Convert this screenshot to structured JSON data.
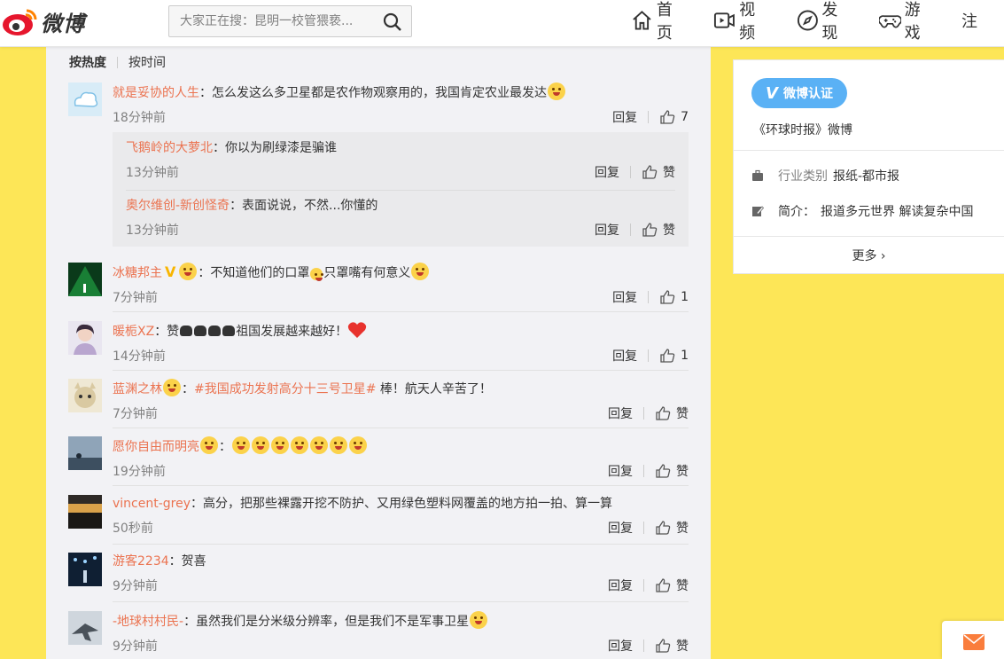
{
  "header": {
    "logo_text": "微博",
    "search_placeholder": "大家正在搜：昆明一校管猥亵...",
    "nav": [
      {
        "label": "首页",
        "icon": "home-icon"
      },
      {
        "label": "视频",
        "icon": "video-icon"
      },
      {
        "label": "发现",
        "icon": "compass-icon"
      },
      {
        "label": "游戏",
        "icon": "gamepad-icon"
      },
      {
        "label": "注",
        "icon": ""
      }
    ]
  },
  "sort": {
    "active": "按热度",
    "other": "按时间"
  },
  "actions": {
    "reply": "回复",
    "like_default": "赞"
  },
  "comments": [
    {
      "user": "就是妥协的人生",
      "text": "：怎么发这么多卫星都是农作物观察用的，我国肯定农业最发达",
      "time": "18分钟前",
      "likes": "7"
    },
    {
      "user": "冰糖邦主",
      "text": "：不知道他们的口罩",
      "text2": "只罩嘴有何意义",
      "time": "7分钟前",
      "likes": "1"
    },
    {
      "user": "暖栀XZ",
      "text": "：赞",
      "text2": "祖国发展越来越好！",
      "time": "14分钟前",
      "likes": "1"
    },
    {
      "user": "蓝渊之林",
      "sep": "：",
      "topic": "#我国成功发射高分十三号卫星#",
      "text": " 棒！航天人辛苦了！",
      "time": "7分钟前",
      "likes": "赞"
    },
    {
      "user": "愿你自由而明亮",
      "text": "：",
      "time": "19分钟前",
      "likes": "赞"
    },
    {
      "user": "vincent-grey",
      "text": "：高分，把那些裸露开挖不防护、又用绿色塑料网覆盖的地方拍一拍、算一算",
      "time": "50秒前",
      "likes": "赞"
    },
    {
      "user": "游客2234",
      "text": "：贺喜",
      "time": "9分钟前",
      "likes": "赞"
    },
    {
      "user": "-地球村村民-",
      "text": "：虽然我们是分米级分辨率，但是我们不是军事卫星",
      "time": "9分钟前",
      "likes": "赞"
    }
  ],
  "replies": [
    {
      "user": "飞鹅岭的大萝北",
      "text": "：你以为刷绿漆是骗谁",
      "time": "13分钟前",
      "likes": "赞"
    },
    {
      "user": "奥尔维创-新创怪奇",
      "text": "：表面说说，不然...你懂的",
      "time": "13分钟前",
      "likes": "赞"
    }
  ],
  "side": {
    "verify_label": "微博认证",
    "verify_mark": "V",
    "name": "《环球时报》微博",
    "industry_label": "行业类别",
    "industry_value": "报纸-都市报",
    "intro_label": "简介：",
    "intro_value": "报道多元世界 解读复杂中国",
    "more": "更多"
  },
  "colors": {
    "background": "#fde657",
    "username": "#eb7350",
    "verify": "#5ab1f5"
  }
}
